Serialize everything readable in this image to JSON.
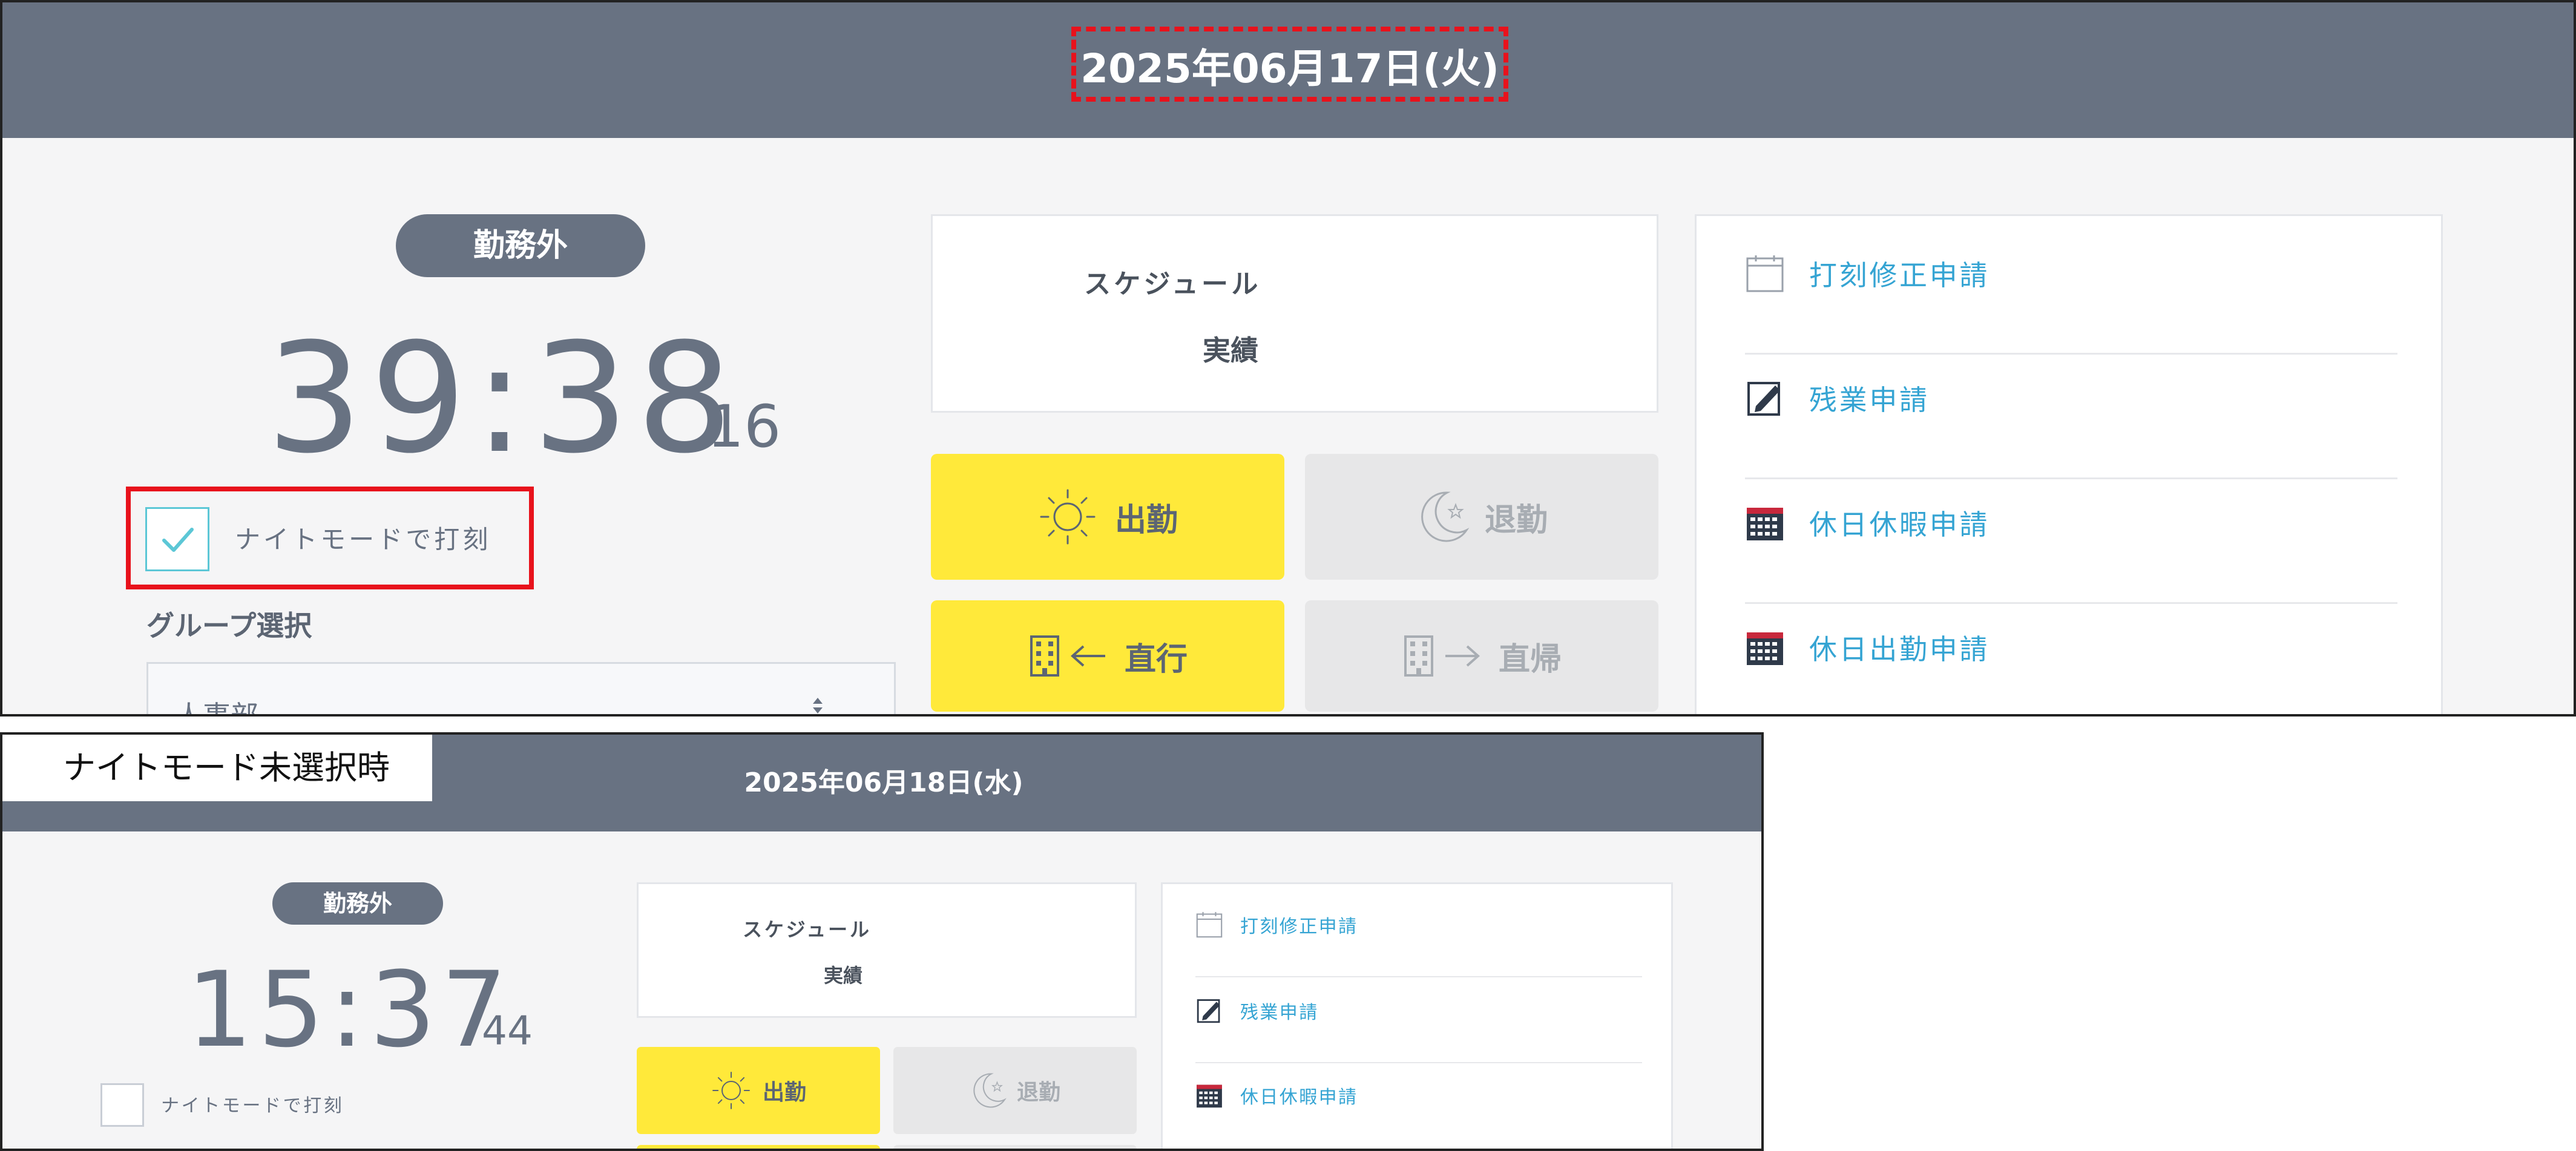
{
  "top": {
    "date": "2025年06月17日(火)",
    "status_badge": "勤務外",
    "clock_hm": "39:38",
    "clock_sec": "16",
    "night_mode_label": "ナイトモードで打刻",
    "night_mode_checked": true,
    "group_label": "グループ選択",
    "group_value": "人事部",
    "schedule_label": "スケジュール",
    "actual_label": "実績",
    "buttons": {
      "clock_in": "出勤",
      "clock_out": "退勤",
      "direct_go": "直行",
      "direct_return": "直帰"
    },
    "menu": [
      {
        "label": "打刻修正申請",
        "icon": "calendar-blank-icon"
      },
      {
        "label": "残業申請",
        "icon": "pencil-note-icon"
      },
      {
        "label": "休日休暇申請",
        "icon": "calendar-grid-icon"
      },
      {
        "label": "休日出勤申請",
        "icon": "calendar-grid-icon"
      }
    ]
  },
  "bottom": {
    "caption": "ナイトモード未選択時",
    "date": "2025年06月18日(水)",
    "status_badge": "勤務外",
    "clock_hm": "15:37",
    "clock_sec": "44",
    "night_mode_label": "ナイトモードで打刻",
    "night_mode_checked": false,
    "schedule_label": "スケジュール",
    "actual_label": "実績",
    "buttons": {
      "clock_in": "出勤",
      "clock_out": "退勤"
    },
    "menu": [
      {
        "label": "打刻修正申請",
        "icon": "calendar-blank-icon"
      },
      {
        "label": "残業申請",
        "icon": "pencil-note-icon"
      },
      {
        "label": "休日休暇申請",
        "icon": "calendar-grid-icon"
      }
    ]
  },
  "colors": {
    "header_bg": "#687282",
    "accent_yellow": "#ffe93a",
    "disabled_gray": "#e7e7e8",
    "link_blue": "#35a4d3",
    "highlight_red": "#e8121c",
    "check_teal": "#5cc7d6"
  }
}
